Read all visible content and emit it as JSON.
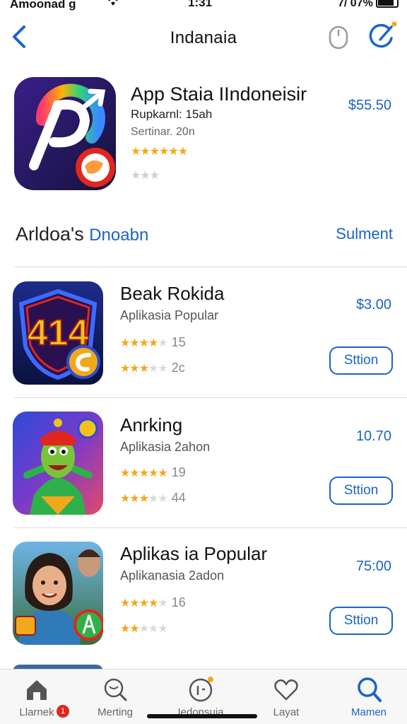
{
  "status": {
    "carrier": "Amoonad g",
    "time": "1:31",
    "battery": "7/ 07%"
  },
  "nav": {
    "title": "Indanaia"
  },
  "featured": {
    "title": "App Staia IIndoneisir",
    "subtitle": "Rupkarnl: 15ah",
    "meta": "Sertinar. 20n",
    "price": "$55.50",
    "stars_line1": "★★★★★★",
    "stars_line2": "★★★"
  },
  "section": {
    "title_dark": "Arldoa's",
    "title_blue": "Dnoabn",
    "more": "Sulment"
  },
  "apps": [
    {
      "name": "Beak Rokida",
      "subtitle": "Aplikasia Popular",
      "stars1_full": "★★★★",
      "stars1_dim": "★",
      "count1": "15",
      "stars2_full": "★★★",
      "stars2_dim": "★★",
      "count2": "2c",
      "price": "$3.00",
      "button": "Sttion",
      "icon_text": "414"
    },
    {
      "name": "Anrking",
      "subtitle": "Aplikasia 2ahon",
      "stars1_full": "★★★★★",
      "stars1_dim": "",
      "count1": "19",
      "stars2_full": "★★★",
      "stars2_dim": "★★",
      "count2": "44",
      "price": "10.70",
      "button": "Sttion",
      "icon_text": ""
    },
    {
      "name": "Aplikas ia Popular",
      "subtitle": "Aplikanasia 2adon",
      "stars1_full": "★★★★",
      "stars1_dim": "★",
      "count1": "16",
      "stars2_full": "★★",
      "stars2_dim": "★★★",
      "count2": "",
      "price": "75:00",
      "button": "Sttion",
      "icon_text": ""
    }
  ],
  "tabs": [
    {
      "label": "Llarnek",
      "badge": "1"
    },
    {
      "label": "Merting"
    },
    {
      "label": "Iedonsuia"
    },
    {
      "label": "Layat"
    },
    {
      "label": "Mamen"
    }
  ],
  "colors": {
    "accent": "#1a64c8",
    "star": "#f2a81b",
    "badge": "#e0261d"
  }
}
